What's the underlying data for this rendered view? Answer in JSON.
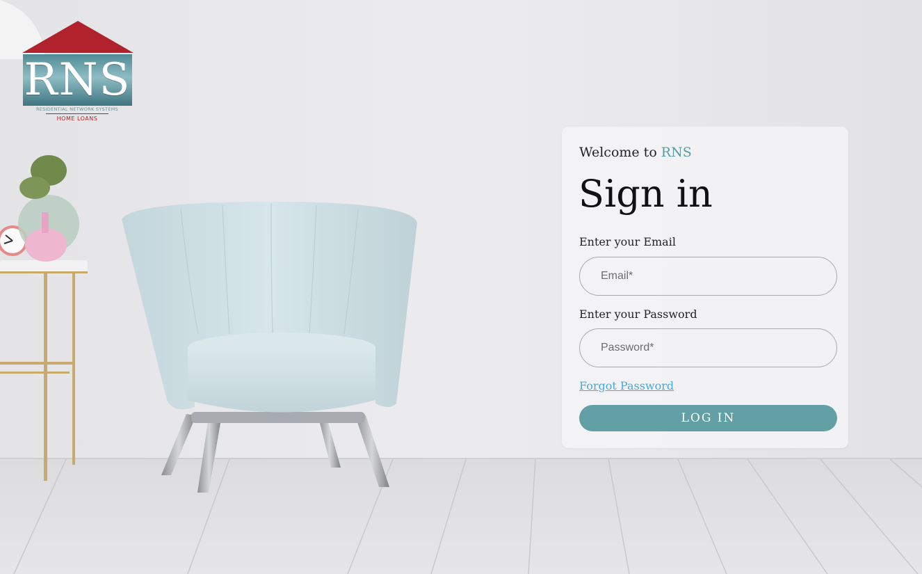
{
  "logo": {
    "letters": "RNS",
    "tagline": "RESIDENTIAL NETWORK SYSTEMS",
    "subtitle": "HOME LOANS"
  },
  "login": {
    "welcome_prefix": "Welcome to ",
    "welcome_brand": "RNS",
    "title": "Sign in",
    "email_label": "Enter your Email",
    "email_placeholder": "Email*",
    "email_value": "",
    "password_label": "Enter your Password",
    "password_placeholder": "Password*",
    "password_value": "",
    "forgot_label": "Forgot Password",
    "submit_label": "LOG IN"
  },
  "colors": {
    "brand_teal": "#62a0a6",
    "brand_red": "#b0232c",
    "link_blue": "#4aa8d8"
  }
}
